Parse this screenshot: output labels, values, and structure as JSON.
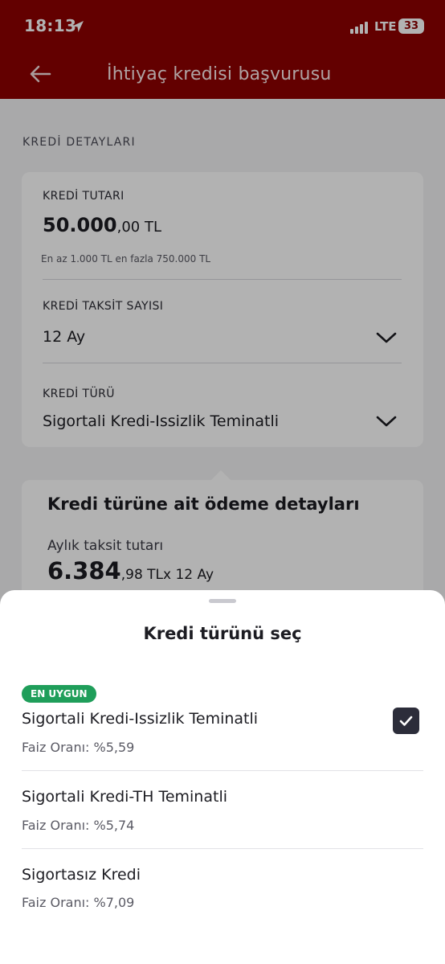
{
  "status": {
    "time": "18:13",
    "network": "LTE",
    "battery": "33"
  },
  "header": {
    "title": "İhtiyaç kredisi başvurusu"
  },
  "form": {
    "section_label": "KREDİ DETAYLARI",
    "amount_label": "KREDİ TUTARI",
    "amount_integer": "50.000",
    "amount_decimal": ",00 TL",
    "amount_hint": "En az 1.000 TL en fazla 750.000 TL",
    "installments_label": "KREDİ TAKSİT SAYISI",
    "installments_value": "12 Ay",
    "type_label": "KREDİ TÜRÜ",
    "type_value": "Sigortali Kredi-Issizlik Teminatli"
  },
  "payment": {
    "title": "Kredi türüne ait ödeme detayları",
    "monthly_label": "Aylık taksit tutarı",
    "monthly_integer": "6.384",
    "monthly_rest": ",98 TLx 12 Ay"
  },
  "sheet": {
    "title": "Kredi türünü seç",
    "options": [
      {
        "badge": "EN UYGUN",
        "name": "Sigortali Kredi-Issizlik Teminatli",
        "rate": "Faiz Oranı: %5,59",
        "selected": true
      },
      {
        "name": "Sigortali Kredi-TH Teminatli",
        "rate": "Faiz Oranı: %5,74",
        "selected": false
      },
      {
        "name": "Sigortasız Kredi",
        "rate": "Faiz Oranı: %7,09",
        "selected": false
      }
    ]
  },
  "colors": {
    "brand": "#8e0000",
    "badge": "#1f9e5a",
    "check": "#2c2d3a"
  }
}
